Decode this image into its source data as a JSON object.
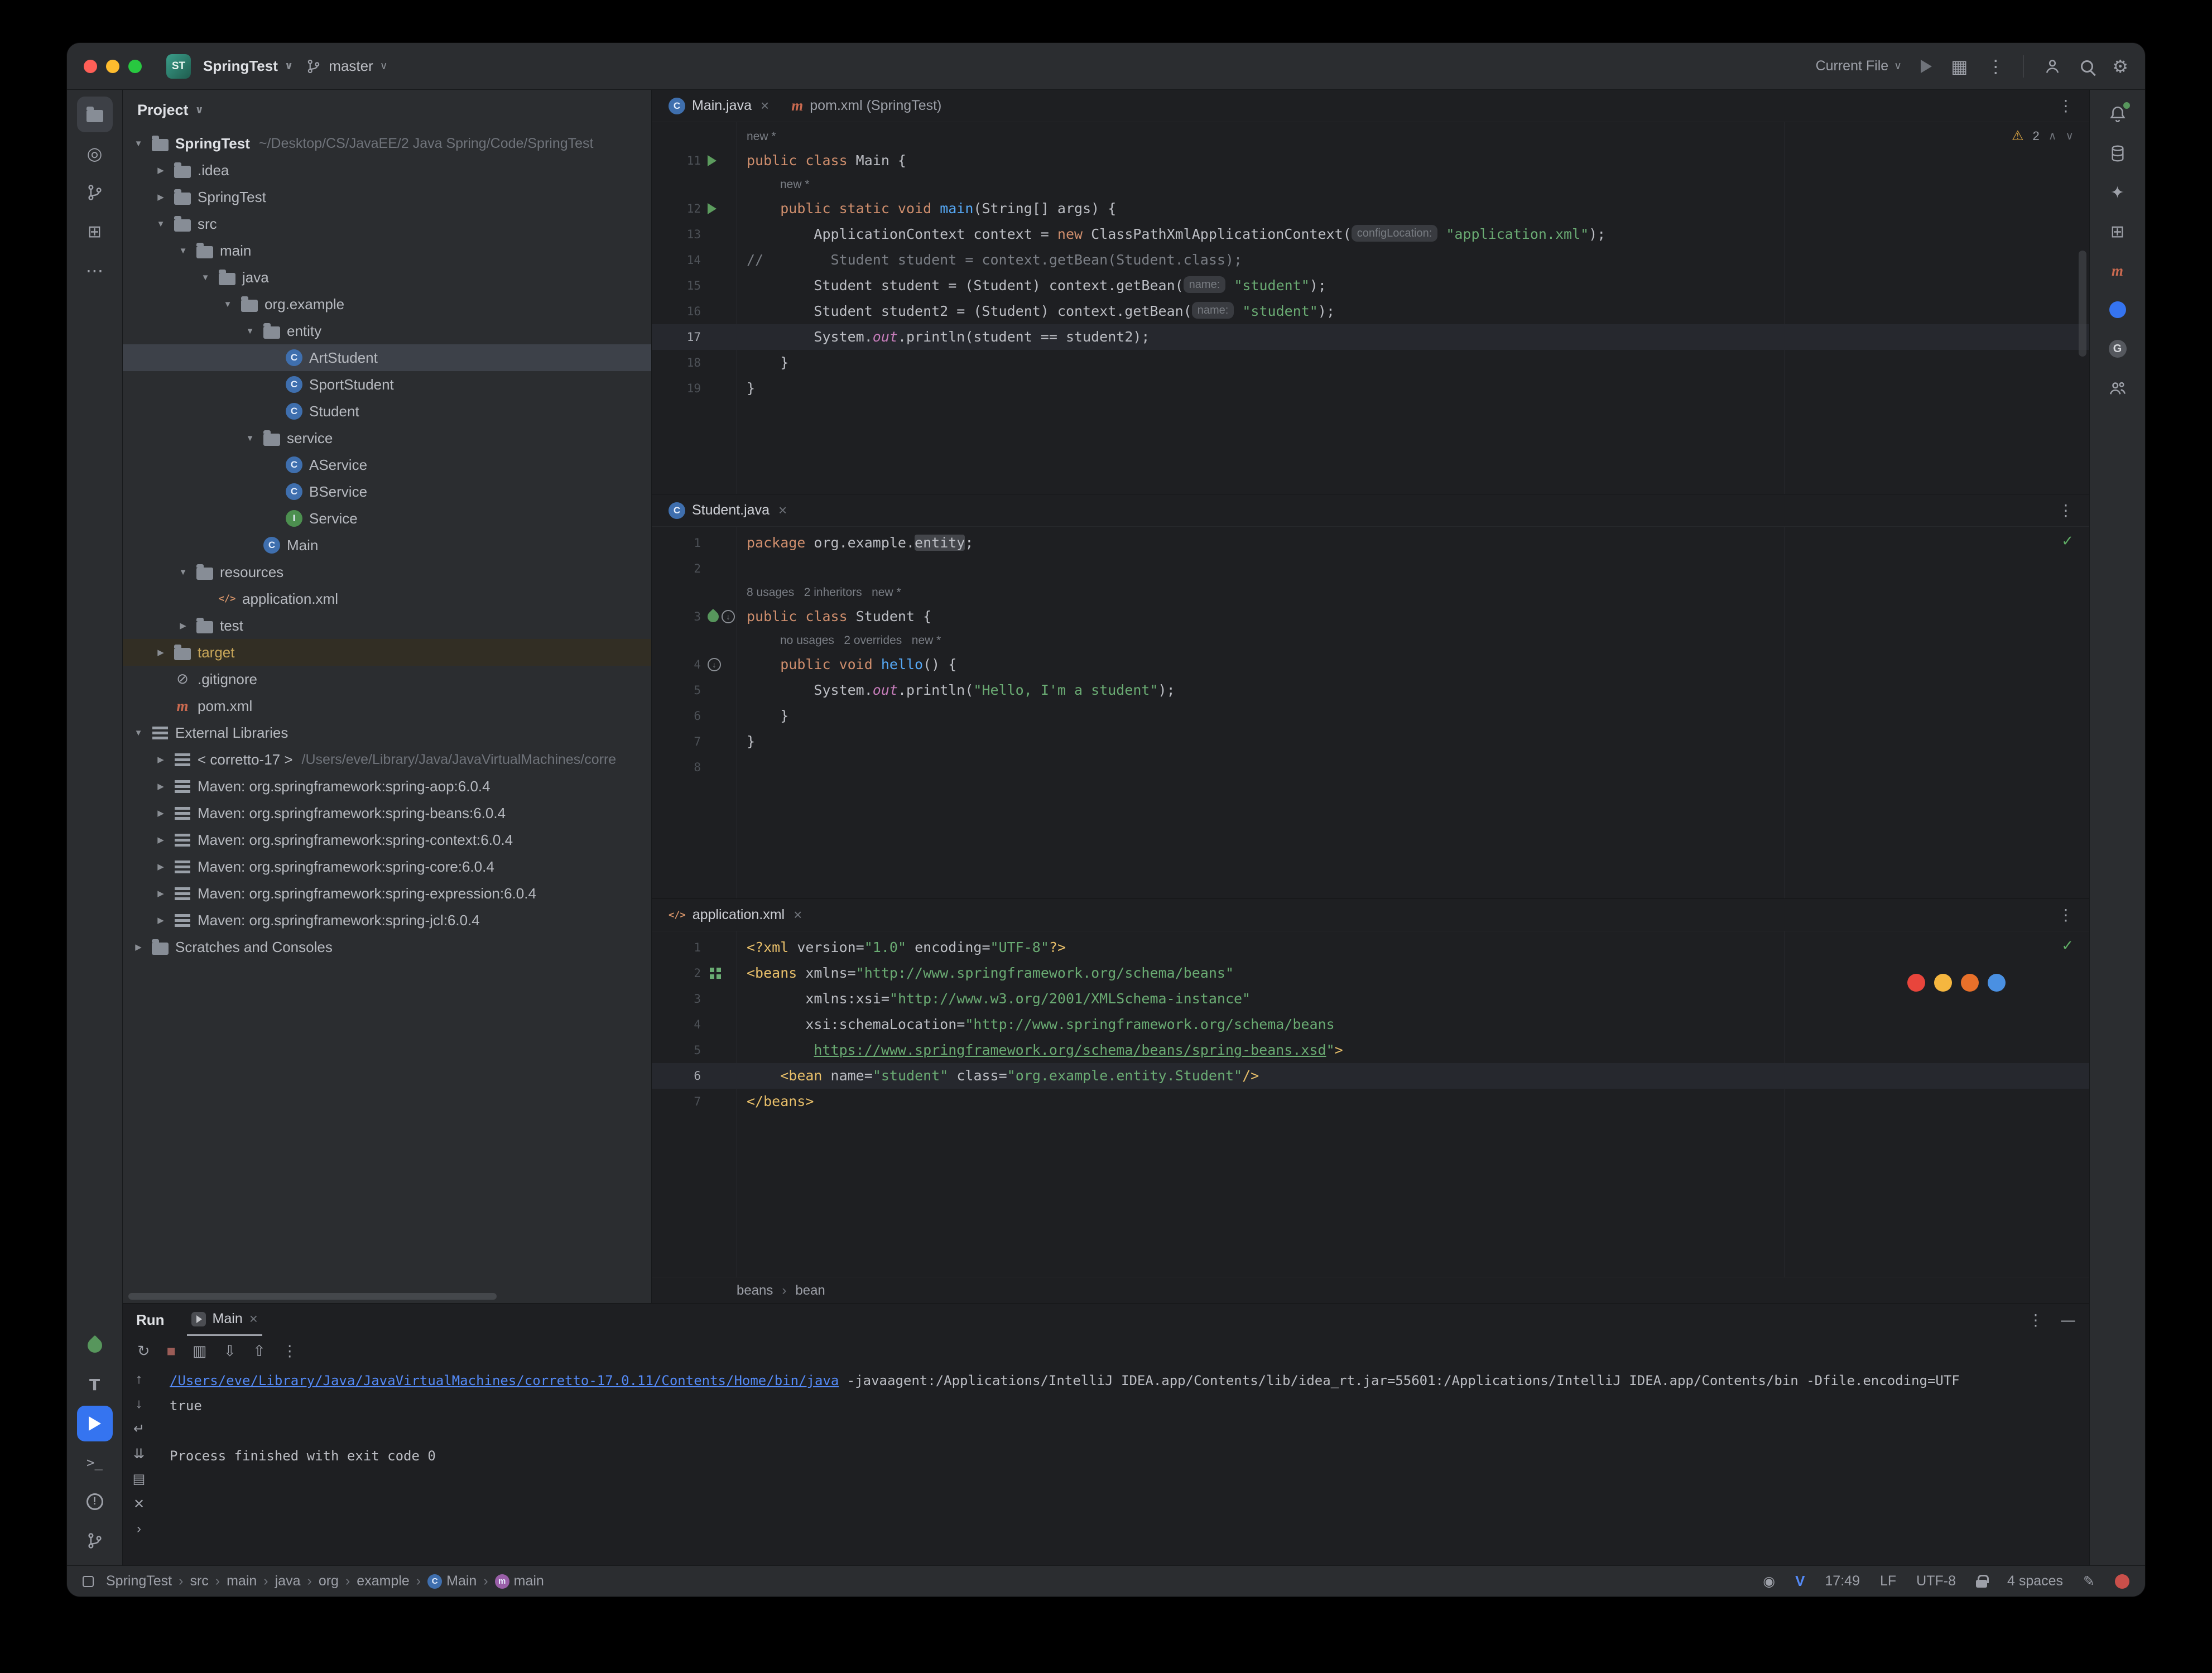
{
  "titlebar": {
    "app_initials": "ST",
    "project_name": "SpringTest",
    "branch": "master",
    "run_config": "Current File"
  },
  "left_strip": {
    "top": [
      {
        "name": "project",
        "kind": "folder",
        "active": true
      },
      {
        "name": "commit",
        "kind": "commit"
      },
      {
        "name": "pull-requests",
        "kind": "pr"
      },
      {
        "name": "structure",
        "kind": "structure"
      },
      {
        "name": "more-tools",
        "kind": "more"
      }
    ],
    "bottom": [
      {
        "name": "spring",
        "kind": "spring"
      },
      {
        "name": "todo",
        "kind": "letterT"
      },
      {
        "name": "run",
        "kind": "run",
        "active_blue": true
      },
      {
        "name": "terminal",
        "kind": "terminal"
      },
      {
        "name": "problems",
        "kind": "problems"
      },
      {
        "name": "version-control",
        "kind": "branch"
      }
    ]
  },
  "right_strip": {
    "items": [
      {
        "name": "notifications",
        "kind": "bell"
      },
      {
        "name": "database",
        "kind": "db"
      },
      {
        "name": "ai-assistant",
        "kind": "ai"
      },
      {
        "name": "plugins",
        "kind": "plugins"
      },
      {
        "name": "maven",
        "kind": "maven"
      },
      {
        "name": "chat",
        "kind": "chat"
      },
      {
        "name": "gradle",
        "kind": "gradle"
      },
      {
        "name": "code-with-me",
        "kind": "users"
      }
    ]
  },
  "project_panel": {
    "title": "Project",
    "tree": [
      {
        "level": 0,
        "chev": "open",
        "kind": "folder",
        "label": "SpringTest",
        "sub": "~/Desktop/CS/JavaEE/2 Java Spring/Code/SpringTest",
        "bold": true
      },
      {
        "level": 1,
        "chev": "closed",
        "kind": "folder",
        "label": ".idea"
      },
      {
        "level": 1,
        "chev": "closed",
        "kind": "folder",
        "label": "SpringTest"
      },
      {
        "level": 1,
        "chev": "open",
        "kind": "folder",
        "label": "src"
      },
      {
        "level": 2,
        "chev": "open",
        "kind": "folder",
        "label": "main"
      },
      {
        "level": 3,
        "chev": "open",
        "kind": "folder",
        "label": "java"
      },
      {
        "level": 4,
        "chev": "open",
        "kind": "folder",
        "label": "org.example"
      },
      {
        "level": 5,
        "chev": "open",
        "kind": "folder",
        "label": "entity"
      },
      {
        "level": 6,
        "chev": "none",
        "kind": "class",
        "label": "ArtStudent",
        "selected": true
      },
      {
        "level": 6,
        "chev": "none",
        "kind": "class",
        "label": "SportStudent"
      },
      {
        "level": 6,
        "chev": "none",
        "kind": "class",
        "label": "Student"
      },
      {
        "level": 5,
        "chev": "open",
        "kind": "folder",
        "label": "service"
      },
      {
        "level": 6,
        "chev": "none",
        "kind": "class",
        "label": "AService"
      },
      {
        "level": 6,
        "chev": "none",
        "kind": "class",
        "label": "BService"
      },
      {
        "level": 6,
        "chev": "none",
        "kind": "interface",
        "label": "Service"
      },
      {
        "level": 5,
        "chev": "none",
        "kind": "class",
        "label": "Main"
      },
      {
        "level": 2,
        "chev": "open",
        "kind": "folder",
        "label": "resources"
      },
      {
        "level": 3,
        "chev": "none",
        "kind": "xml",
        "label": "application.xml"
      },
      {
        "level": 2,
        "chev": "closed",
        "kind": "folder",
        "label": "test"
      },
      {
        "level": 1,
        "chev": "closed",
        "kind": "folder",
        "label": "target",
        "excluded": true
      },
      {
        "level": 1,
        "chev": "none",
        "kind": "ignore",
        "label": ".gitignore"
      },
      {
        "level": 1,
        "chev": "none",
        "kind": "maven",
        "label": "pom.xml"
      },
      {
        "level": 0,
        "chev": "open",
        "kind": "extlib",
        "label": "External Libraries"
      },
      {
        "level": 1,
        "chev": "closed",
        "kind": "jdk",
        "label": "< corretto-17 >",
        "sub": "/Users/eve/Library/Java/JavaVirtualMachines/corre"
      },
      {
        "level": 1,
        "chev": "closed",
        "kind": "lib",
        "label": "Maven: org.springframework:spring-aop:6.0.4"
      },
      {
        "level": 1,
        "chev": "closed",
        "kind": "lib",
        "label": "Maven: org.springframework:spring-beans:6.0.4"
      },
      {
        "level": 1,
        "chev": "closed",
        "kind": "lib",
        "label": "Maven: org.springframework:spring-context:6.0.4"
      },
      {
        "level": 1,
        "chev": "closed",
        "kind": "lib",
        "label": "Maven: org.springframework:spring-core:6.0.4"
      },
      {
        "level": 1,
        "chev": "closed",
        "kind": "lib",
        "label": "Maven: org.springframework:spring-expression:6.0.4"
      },
      {
        "level": 1,
        "chev": "closed",
        "kind": "lib",
        "label": "Maven: org.springframework:spring-jcl:6.0.4"
      },
      {
        "level": 0,
        "chev": "closed",
        "kind": "scratch",
        "label": "Scratches and Consoles"
      }
    ]
  },
  "editors": [
    {
      "tabs": [
        {
          "kind": "class",
          "label": "Main.java",
          "close": true,
          "active": true
        },
        {
          "kind": "maven",
          "label": "pom.xml (SpringTest)"
        }
      ],
      "widget": {
        "type": "warnings",
        "count": "2"
      },
      "lines": [
        {
          "ann": "new *",
          "indent": 0
        },
        {
          "n": "11",
          "g": [
            "run"
          ],
          "tok": [
            [
              "kw",
              "public class "
            ],
            [
              "t",
              "Main {"
            ]
          ]
        },
        {
          "ann": "new *",
          "indent": 4
        },
        {
          "n": "12",
          "g": [
            "run"
          ],
          "tok": [
            [
              "t",
              "    "
            ],
            [
              "kw",
              "public static void "
            ],
            [
              "fn",
              "main"
            ],
            [
              "t",
              "(String[] args) {"
            ]
          ]
        },
        {
          "n": "13",
          "tok": [
            [
              "t",
              "        ApplicationContext context = "
            ],
            [
              "kw",
              "new"
            ],
            [
              "t",
              " ClassPathXmlApplicationContext("
            ],
            [
              "hint",
              "configLocation:"
            ],
            [
              "t",
              " "
            ],
            [
              "str",
              "\"application.xml\""
            ],
            [
              "t",
              ");"
            ]
          ]
        },
        {
          "n": "14",
          "tok": [
            [
              "cmt",
              "//        Student student = context.getBean(Student.class);"
            ]
          ]
        },
        {
          "n": "15",
          "tok": [
            [
              "t",
              "        Student student = (Student) context.getBean("
            ],
            [
              "hint",
              "name:"
            ],
            [
              "t",
              " "
            ],
            [
              "str",
              "\"student\""
            ],
            [
              "t",
              ");"
            ]
          ]
        },
        {
          "n": "16",
          "tok": [
            [
              "t",
              "        Student student2 = (Student) context.getBean("
            ],
            [
              "hint",
              "name:"
            ],
            [
              "t",
              " "
            ],
            [
              "str",
              "\"student\""
            ],
            [
              "t",
              ");"
            ]
          ]
        },
        {
          "n": "17",
          "cur": true,
          "tok": [
            [
              "t",
              "        System."
            ],
            [
              "fld",
              "out"
            ],
            [
              "t",
              ".println(student == student2);"
            ]
          ]
        },
        {
          "n": "18",
          "tok": [
            [
              "t",
              "    }"
            ]
          ]
        },
        {
          "n": "19",
          "tok": [
            [
              "t",
              "}"
            ]
          ]
        }
      ]
    },
    {
      "tabs": [
        {
          "kind": "class",
          "label": "Student.java",
          "close": true,
          "active": true
        }
      ],
      "widget": {
        "type": "ok"
      },
      "lines": [
        {
          "n": "1",
          "tok": [
            [
              "kw",
              "package "
            ],
            [
              "t",
              "org.example."
            ],
            [
              "hl",
              "entity"
            ],
            [
              "t",
              ";"
            ]
          ]
        },
        {
          "n": "2",
          "tok": []
        },
        {
          "ann": "8 usages   2 inheritors   new *",
          "indent": 0
        },
        {
          "n": "3",
          "g": [
            "leaf",
            "ring"
          ],
          "tok": [
            [
              "kw",
              "public class "
            ],
            [
              "t",
              "Student {"
            ]
          ]
        },
        {
          "ann": "no usages   2 overrides   new *",
          "indent": 4
        },
        {
          "n": "4",
          "g": [
            "ring"
          ],
          "tok": [
            [
              "t",
              "    "
            ],
            [
              "kw",
              "public void "
            ],
            [
              "fn",
              "hello"
            ],
            [
              "t",
              "() {"
            ]
          ]
        },
        {
          "n": "5",
          "tok": [
            [
              "t",
              "        System."
            ],
            [
              "fld",
              "out"
            ],
            [
              "t",
              ".println("
            ],
            [
              "str",
              "\"Hello, I'm a student\""
            ],
            [
              "t",
              ");"
            ]
          ]
        },
        {
          "n": "6",
          "tok": [
            [
              "t",
              "    }"
            ]
          ]
        },
        {
          "n": "7",
          "tok": [
            [
              "t",
              "}"
            ]
          ]
        },
        {
          "n": "8",
          "tok": []
        }
      ]
    },
    {
      "tabs": [
        {
          "kind": "xml",
          "label": "application.xml",
          "close": true,
          "active": true
        }
      ],
      "widget": {
        "type": "ok"
      },
      "breadcrumbs": [
        "beans",
        "bean"
      ],
      "browser_icons": [
        {
          "name": "chrome",
          "color": "#e8453c"
        },
        {
          "name": "firefox",
          "color": "#f5b63f"
        },
        {
          "name": "opera",
          "color": "#e8702a"
        },
        {
          "name": "safari",
          "color": "#4a90e2"
        }
      ],
      "lines": [
        {
          "n": "1",
          "tok": [
            [
              "tag",
              "<?xml "
            ],
            [
              "attr",
              "version"
            ],
            [
              "t",
              "="
            ],
            [
              "str",
              "\"1.0\""
            ],
            [
              "t",
              " "
            ],
            [
              "attr",
              "encoding"
            ],
            [
              "t",
              "="
            ],
            [
              "str",
              "\"UTF-8\""
            ],
            [
              "tag",
              "?>"
            ]
          ]
        },
        {
          "n": "2",
          "g": [
            "grid"
          ],
          "tok": [
            [
              "tag",
              "<beans "
            ],
            [
              "attr",
              "xmlns"
            ],
            [
              "t",
              "="
            ],
            [
              "str",
              "\"http://www.springframework.org/schema/beans\""
            ]
          ]
        },
        {
          "n": "3",
          "tok": [
            [
              "t",
              "       "
            ],
            [
              "attr",
              "xmlns:xsi"
            ],
            [
              "t",
              "="
            ],
            [
              "str",
              "\"http://www.w3.org/2001/XMLSchema-instance\""
            ]
          ]
        },
        {
          "n": "4",
          "tok": [
            [
              "t",
              "       "
            ],
            [
              "attr",
              "xsi:schemaLocation"
            ],
            [
              "t",
              "="
            ],
            [
              "str",
              "\"http://www.springframework.org/schema/beans"
            ]
          ]
        },
        {
          "n": "5",
          "tok": [
            [
              "t",
              "        "
            ],
            [
              "strl",
              "https://www.springframework.org/schema/beans/spring-beans.xsd"
            ],
            [
              "str",
              "\""
            ],
            [
              "tag",
              ">"
            ]
          ]
        },
        {
          "n": "6",
          "cur": true,
          "tok": [
            [
              "t",
              "    "
            ],
            [
              "tag",
              "<bean "
            ],
            [
              "attr",
              "name"
            ],
            [
              "t",
              "="
            ],
            [
              "str",
              "\"student\""
            ],
            [
              "t",
              " "
            ],
            [
              "attr",
              "class"
            ],
            [
              "t",
              "="
            ],
            [
              "str",
              "\"org.example.entity.Student\""
            ],
            [
              "tag",
              "/>"
            ]
          ]
        },
        {
          "n": "7",
          "tok": [
            [
              "tag",
              "</beans>"
            ]
          ]
        }
      ]
    }
  ],
  "run_panel": {
    "title": "Run",
    "tab": "Main",
    "toolbar": [
      {
        "name": "rerun",
        "glyph": "↻"
      },
      {
        "name": "stop",
        "glyph": "■",
        "cls": "stop"
      },
      {
        "name": "dump-threads",
        "glyph": "▥"
      },
      {
        "name": "import-results",
        "glyph": "⇩"
      },
      {
        "name": "export-results",
        "glyph": "⇧"
      },
      {
        "name": "more-options",
        "glyph": "⋮"
      }
    ],
    "console_strip": [
      {
        "name": "scroll-up",
        "glyph": "↑"
      },
      {
        "name": "scroll-down",
        "glyph": "↓"
      },
      {
        "name": "soft-wrap",
        "glyph": "↵"
      },
      {
        "name": "scroll-to-end",
        "glyph": "⇊"
      },
      {
        "name": "print",
        "glyph": "▤"
      },
      {
        "name": "clear",
        "glyph": "✕"
      },
      {
        "name": "expand",
        "glyph": "›"
      }
    ],
    "console": [
      {
        "tok": [
          [
            "link",
            "/Users/eve/Library/Java/JavaVirtualMachines/corretto-17.0.11/Contents/Home/bin/java"
          ],
          [
            "t",
            " -javaagent:/Applications/IntelliJ IDEA.app/Contents/lib/idea_rt.jar=55601:/Applications/IntelliJ IDEA.app/Contents/bin -Dfile.encoding=UTF"
          ]
        ]
      },
      {
        "tok": [
          [
            "t",
            "true"
          ]
        ]
      },
      {
        "tok": []
      },
      {
        "tok": [
          [
            "t",
            "Process finished with exit code 0"
          ]
        ]
      }
    ]
  },
  "status_bar": {
    "crumbs": [
      {
        "label": "SpringTest"
      },
      {
        "label": "src"
      },
      {
        "label": "main"
      },
      {
        "label": "java"
      },
      {
        "label": "org"
      },
      {
        "label": "example"
      },
      {
        "label": "Main",
        "kind": "class"
      },
      {
        "label": "main",
        "kind": "method"
      }
    ],
    "vim": "V",
    "position": "17:49",
    "line_ending": "LF",
    "encoding": "UTF-8",
    "indent": "4 spaces"
  }
}
